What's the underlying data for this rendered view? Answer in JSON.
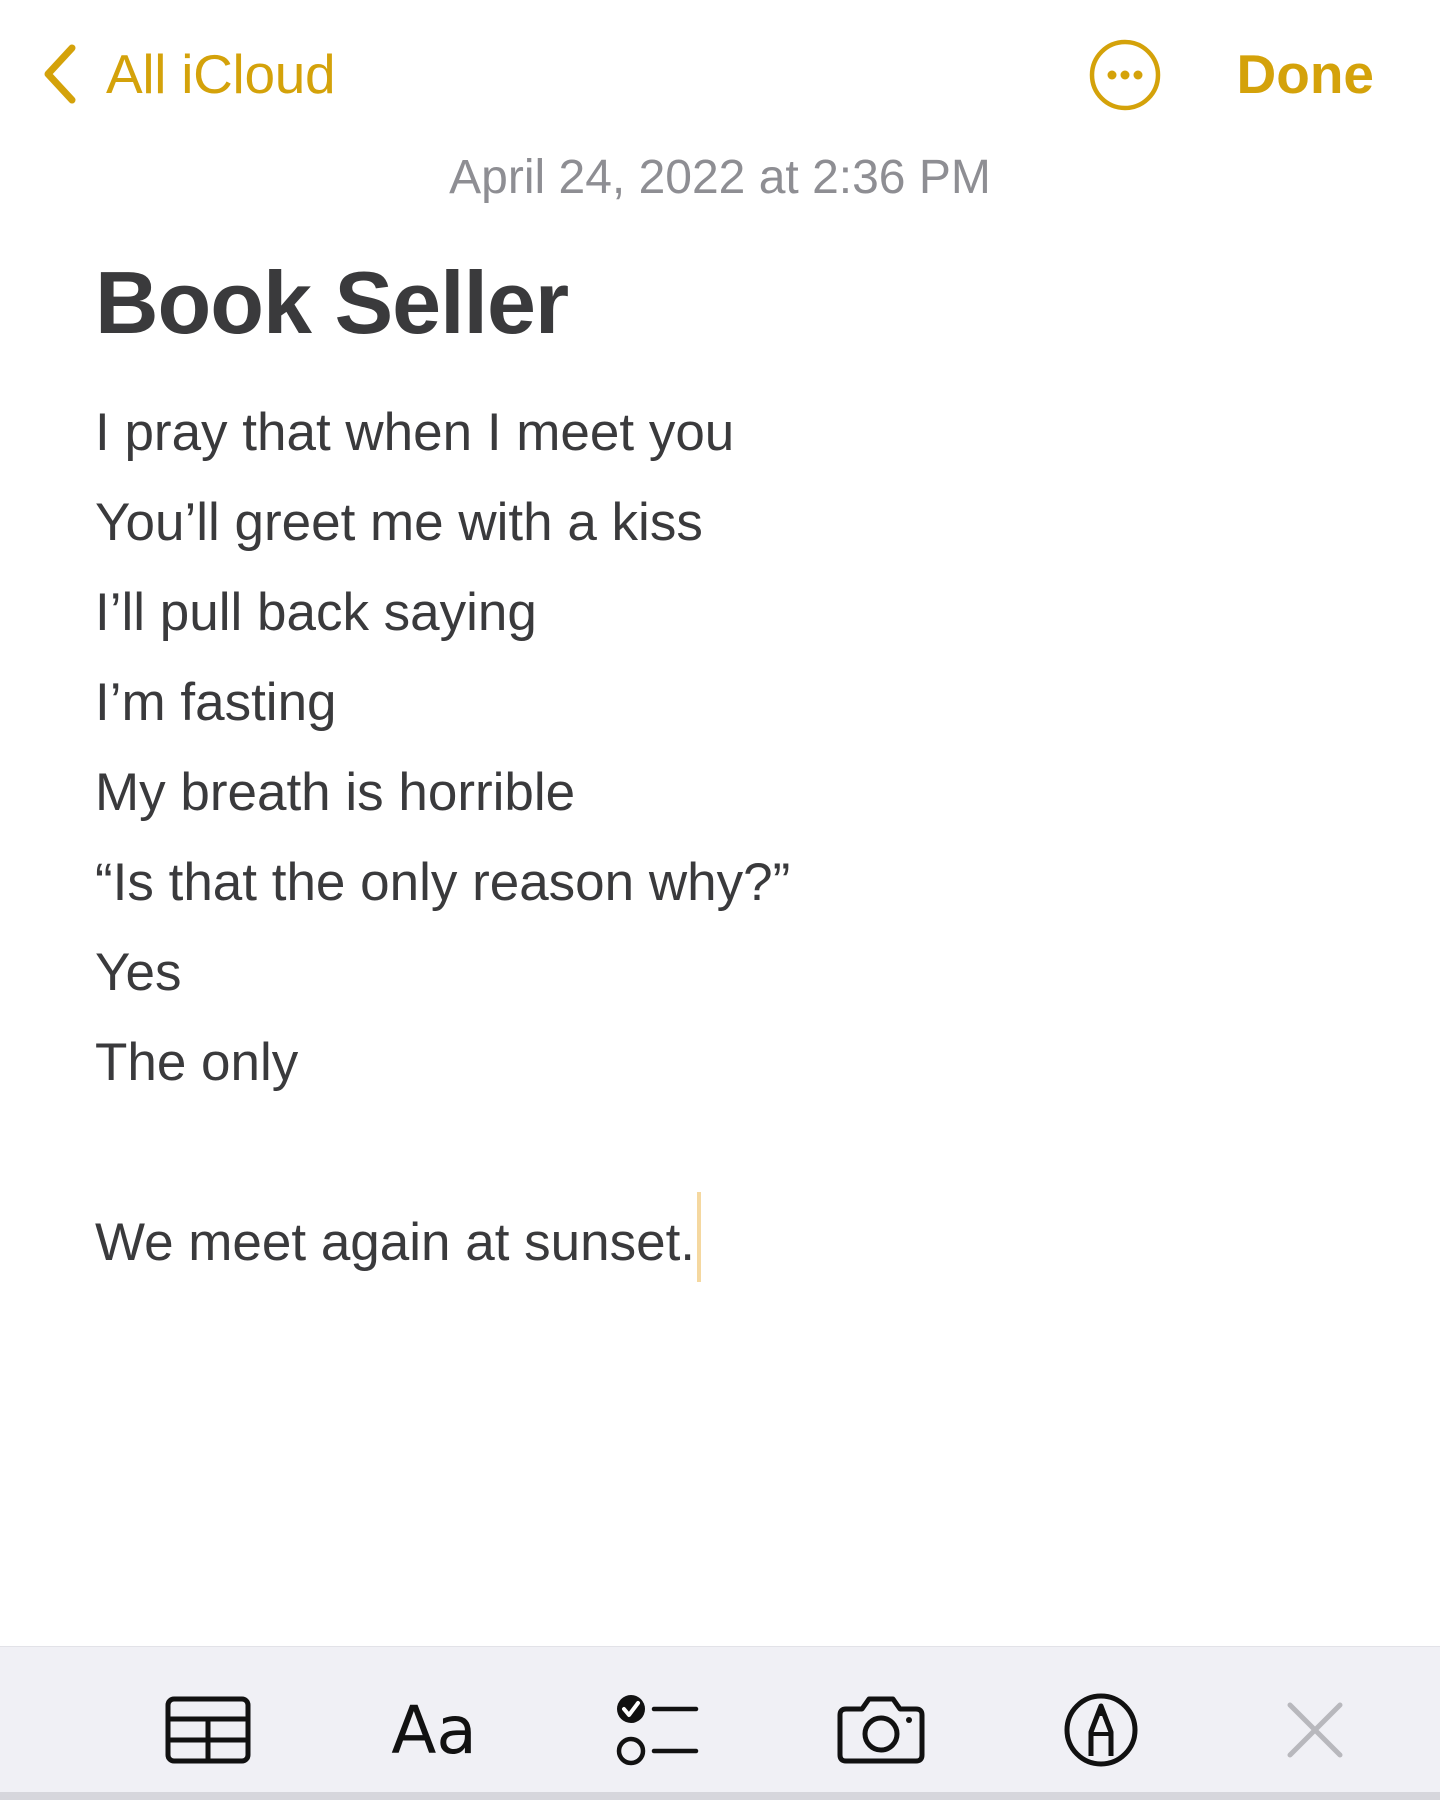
{
  "nav": {
    "back_label": "All iCloud",
    "done_label": "Done",
    "accent_color": "#d4a20a"
  },
  "note": {
    "timestamp": "April 24, 2022 at 2:36 PM",
    "title": "Book Seller",
    "lines": [
      "I pray that when I meet you",
      "You’ll greet me with a kiss",
      "I’ll pull back saying",
      "I’m fasting",
      "My breath is horrible",
      "“Is that the only reason why?”",
      "Yes",
      "The only",
      "",
      "We meet again at sunset."
    ]
  },
  "toolbar": {
    "items": [
      {
        "icon": "table-icon"
      },
      {
        "icon": "text-format-icon",
        "label": "Aa"
      },
      {
        "icon": "checklist-icon"
      },
      {
        "icon": "camera-icon"
      },
      {
        "icon": "markup-pen-icon"
      },
      {
        "icon": "close-icon"
      }
    ]
  }
}
